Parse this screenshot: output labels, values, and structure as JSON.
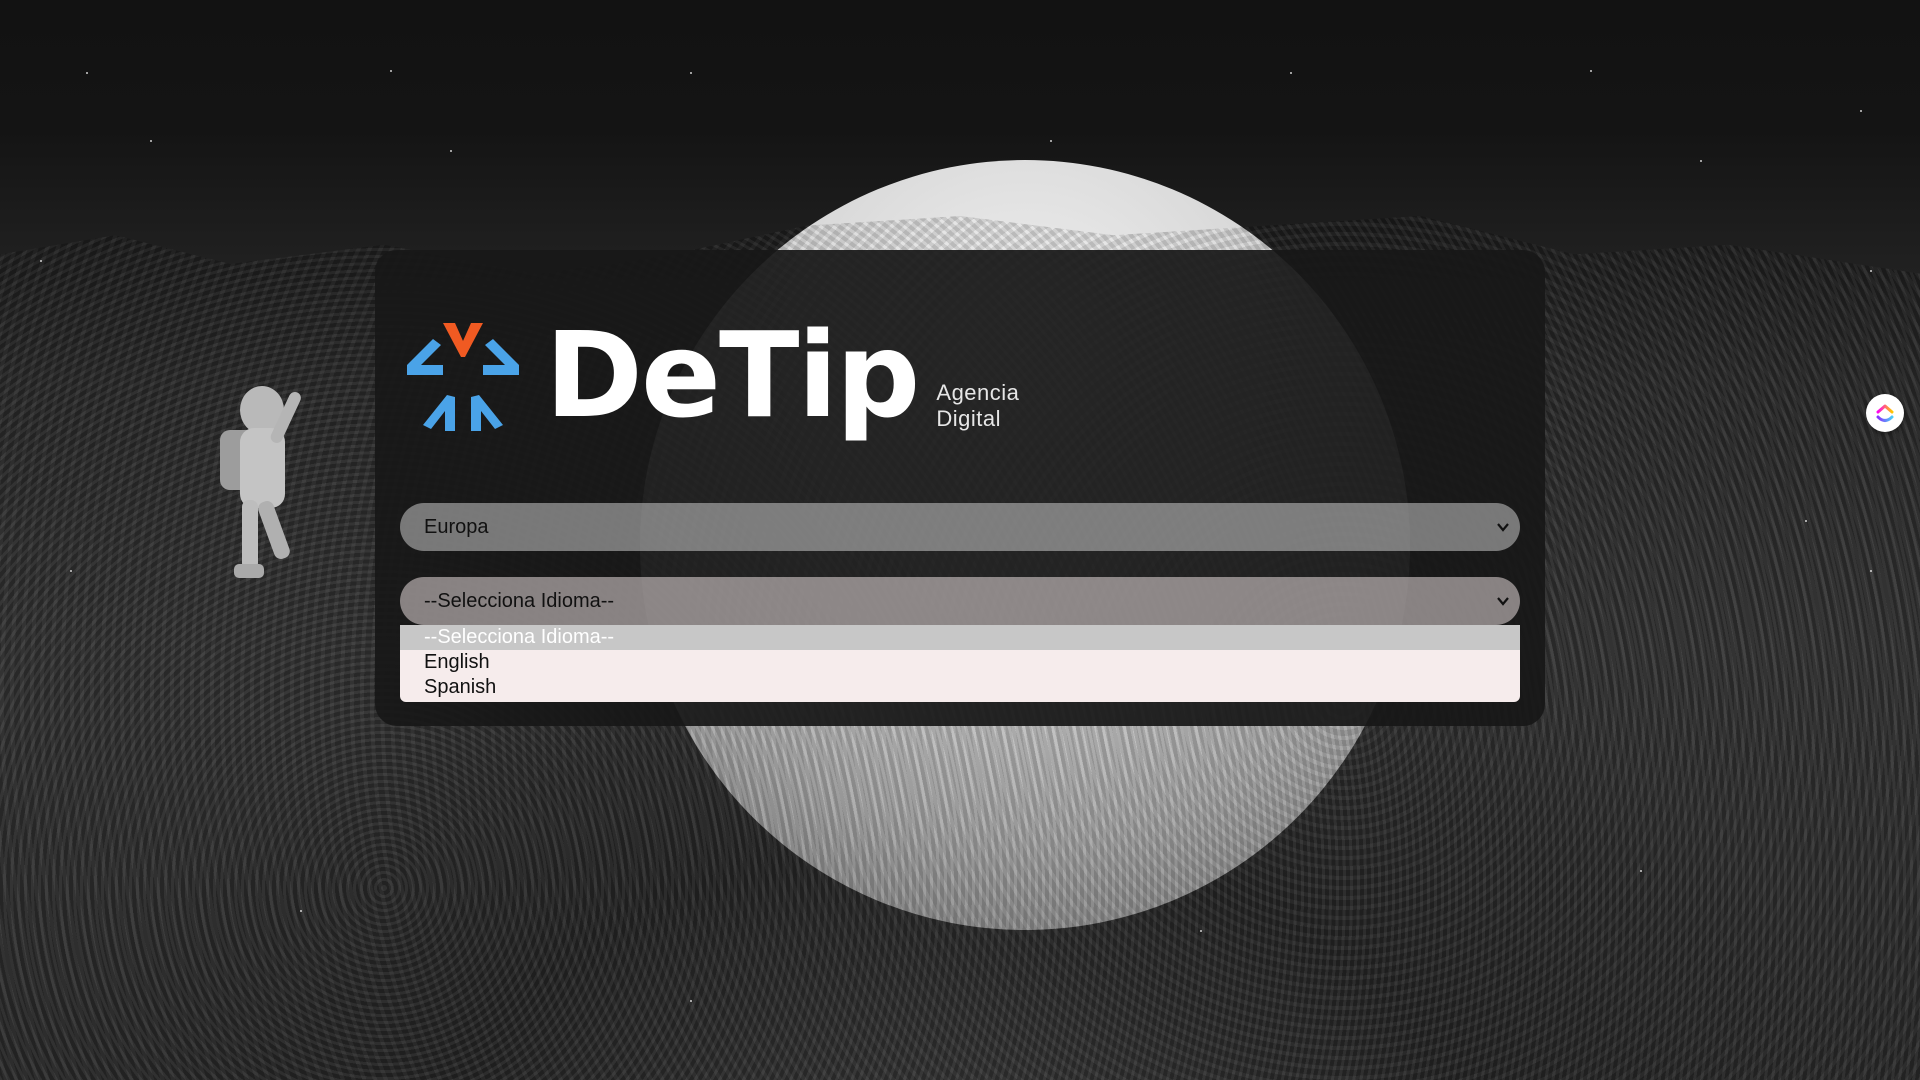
{
  "brand": {
    "name": "DeTip",
    "subtitle_line1": "Agencia",
    "subtitle_line2": "Digital",
    "colors": {
      "accent_orange": "#F05A22",
      "accent_blue": "#4AA3E8",
      "text": "#FFFFFF"
    }
  },
  "form": {
    "region_select": {
      "selected": "Europa"
    },
    "language_select": {
      "selected": "--Selecciona Idioma--",
      "options": [
        {
          "label": "--Selecciona Idioma--",
          "highlighted": true
        },
        {
          "label": "English",
          "highlighted": false
        },
        {
          "label": "Spanish",
          "highlighted": false
        }
      ]
    }
  },
  "icons": {
    "dropdown_indicator": "chevron-down-icon",
    "floating_widget": "clickup-icon"
  }
}
